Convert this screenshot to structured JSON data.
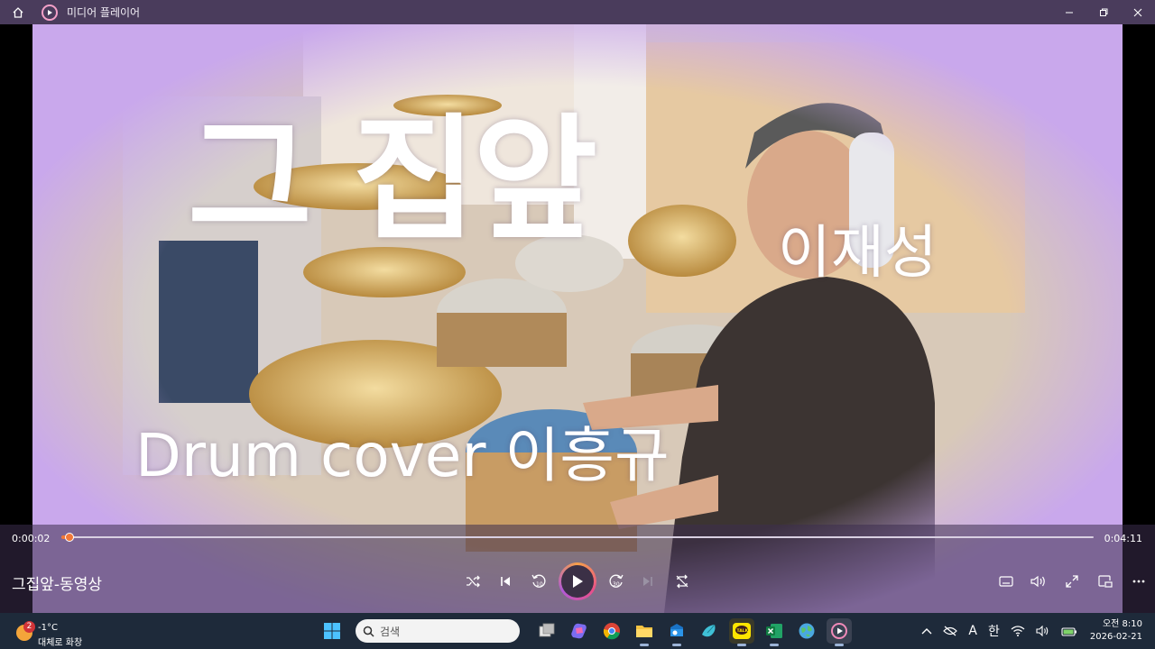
{
  "window": {
    "title": "미디어 플레이어",
    "accent": "#f07838"
  },
  "video": {
    "song_title": "그 집앞",
    "singer": "이재성",
    "cover_credit": "Drum cover  이흥규"
  },
  "player": {
    "current_time": "0:00:02",
    "total_time": "0:04:11",
    "progress": 0.008,
    "media_title": "그집앞-동영상",
    "buttons": [
      "shuffle",
      "previous",
      "rewind-10",
      "play",
      "forward-30",
      "next",
      "repeat-off"
    ],
    "right_buttons": [
      "subtitles",
      "volume",
      "fullscreen",
      "mini-player",
      "more"
    ]
  },
  "taskbar": {
    "weather_badge": "2",
    "temperature": "-1°C",
    "weather_desc": "대체로 화창",
    "search_placeholder": "검색",
    "tray_font": "A",
    "tray_ime": "한",
    "clock_time": "오전 8:10",
    "clock_date": "2026-02-21"
  }
}
